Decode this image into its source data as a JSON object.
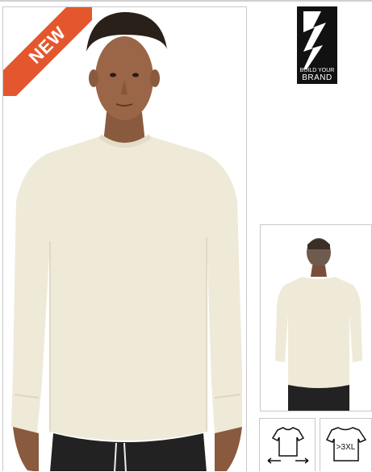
{
  "badge": {
    "text": "NEW"
  },
  "brand": {
    "line1": "BUILD YOUR",
    "line2": "BRAND"
  },
  "icons": {
    "fit": "oversized-fit-icon",
    "size_label": ">3XL"
  },
  "colors": {
    "ribbon": "#e4572e",
    "shirt": "#efe9d8",
    "pants": "#222222"
  }
}
